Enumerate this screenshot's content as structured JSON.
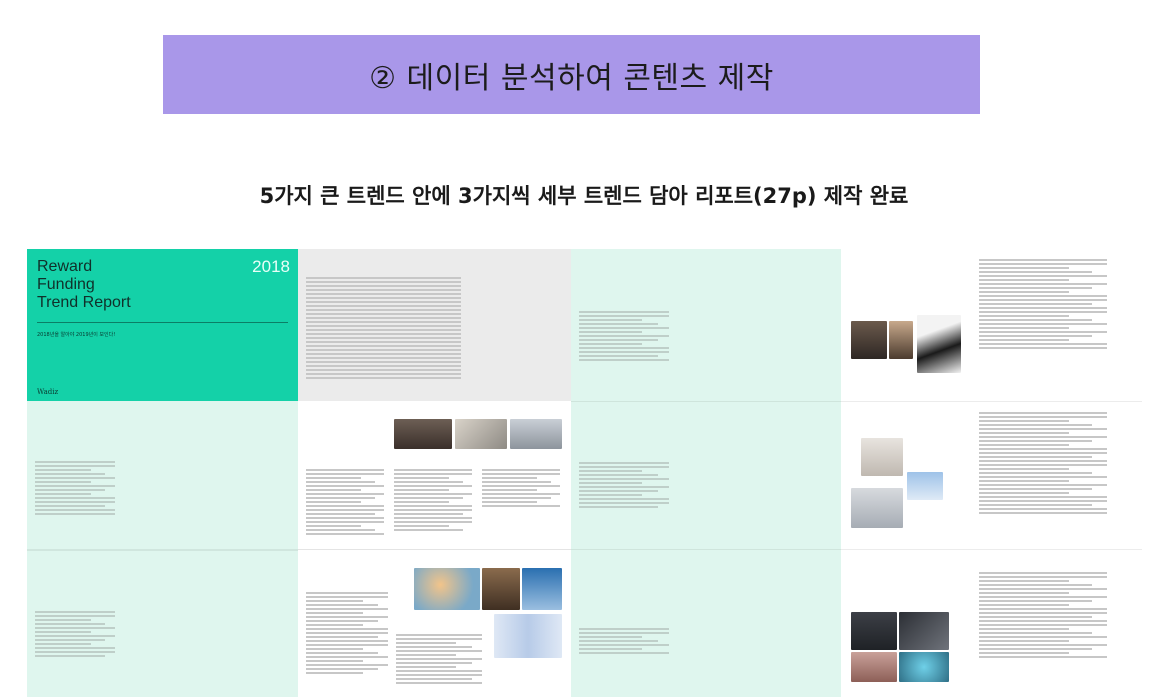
{
  "banner": {
    "title": "② 데이터 분석하여 콘텐츠 제작"
  },
  "subtitle": "5가지 큰 트렌드 안에 3가지씩 세부 트렌드 담아 리포트(27p) 제작 완료",
  "cover": {
    "title_lines": [
      "Reward",
      "Funding",
      "Trend Report"
    ],
    "year": "2018",
    "tagline": "2018년을 알아야 2019년이 보인다!",
    "logo": "Wadiz"
  },
  "colors": {
    "banner": "#a997e9",
    "cover": "#14d1a8",
    "mint_page": "#dff6ee",
    "gray_page": "#ebebeb"
  }
}
